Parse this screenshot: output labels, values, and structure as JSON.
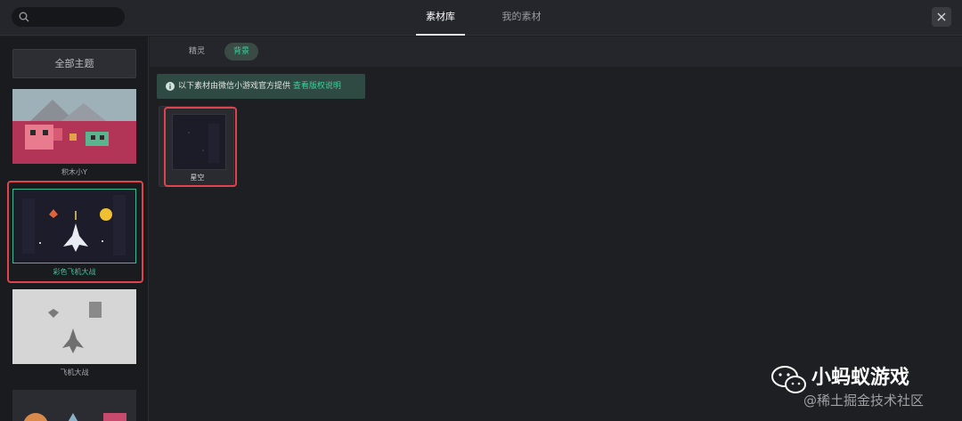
{
  "search": {
    "placeholder": ""
  },
  "header": {
    "tabs": [
      {
        "label": "素材库",
        "active": true
      },
      {
        "label": "我的素材",
        "active": false
      }
    ]
  },
  "sidebar": {
    "all_themes_label": "全部主题",
    "themes": [
      {
        "label": "积木小Y",
        "selected": false
      },
      {
        "label": "彩色飞机大战",
        "selected": true
      },
      {
        "label": "飞机大战",
        "selected": false
      },
      {
        "label": "",
        "selected": false
      }
    ]
  },
  "subtabs": [
    {
      "label": "精灵",
      "active": false
    },
    {
      "label": "背景",
      "active": true
    }
  ],
  "notice": {
    "text": "以下素材由微信小游戏官方提供",
    "link": "查看版权说明"
  },
  "assets": [
    {
      "label": "星空"
    }
  ],
  "watermark": {
    "title": "小蚂蚁游戏",
    "subtitle": "@稀土掘金技术社区"
  },
  "colors": {
    "accent": "#3bd09d",
    "highlight_frame": "#e0434b",
    "background": "#1e1f23"
  }
}
